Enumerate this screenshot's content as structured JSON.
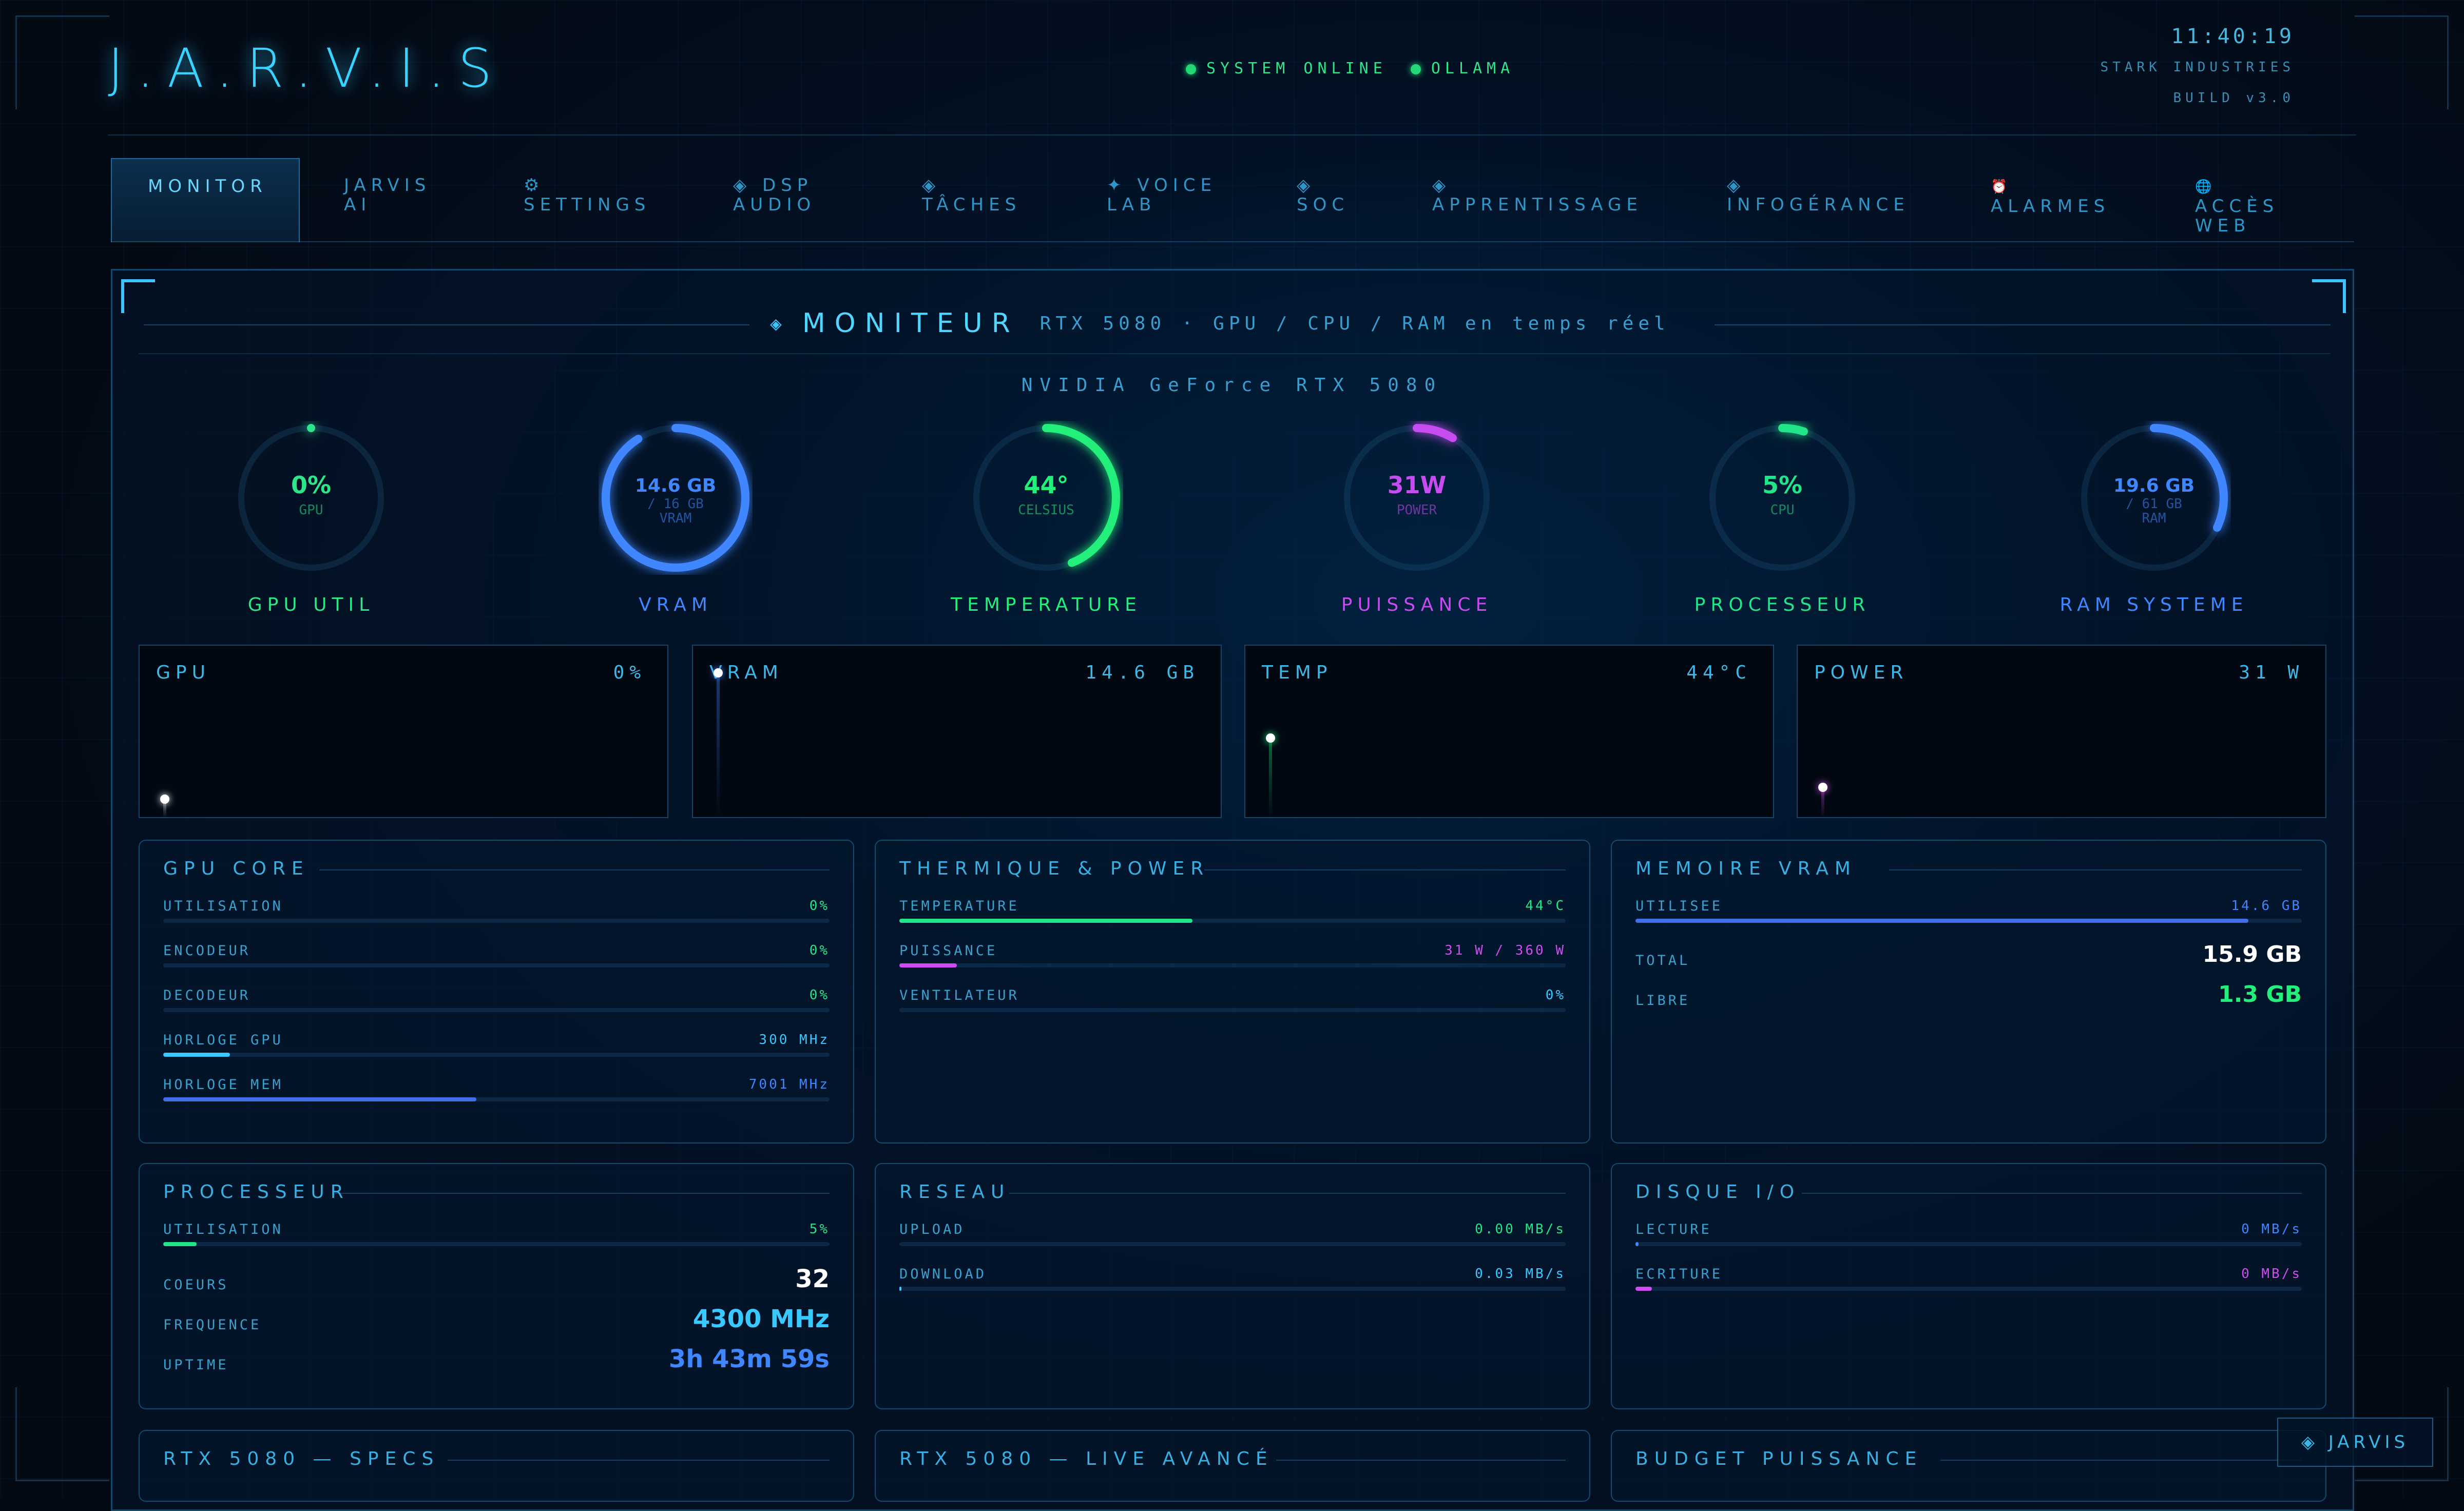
{
  "header": {
    "logo": "J.A.R.V.I.S",
    "status_1": "SYSTEM ONLINE",
    "status_2": "OLLAMA",
    "clock": "11:40:19",
    "company": "STARK INDUSTRIES",
    "build": "BUILD v3.0"
  },
  "tabs": [
    {
      "label": "MONITOR",
      "icon": "",
      "active": true
    },
    {
      "label": "JARVIS AI",
      "icon": ""
    },
    {
      "label": "SETTINGS",
      "icon": "⚙"
    },
    {
      "label": "DSP AUDIO",
      "icon": "◈"
    },
    {
      "label": "TÂCHES",
      "icon": "◈"
    },
    {
      "label": "VOICE LAB",
      "icon": "✦"
    },
    {
      "label": "SOC",
      "icon": "◈"
    },
    {
      "label": "APPRENTISSAGE",
      "icon": "◈"
    },
    {
      "label": "INFOGÉRANCE",
      "icon": "◈"
    },
    {
      "label": "ALARMES",
      "icon": "⏰"
    },
    {
      "label": "ACCÈS WEB",
      "icon": "🌐"
    }
  ],
  "section": {
    "icon": "◈",
    "title": "MONITEUR",
    "subtitle": "RTX 5080 · GPU / CPU / RAM en temps réel",
    "gpu_name": "NVIDIA GeForce RTX 5080"
  },
  "gauges": [
    {
      "value": "0%",
      "sub1": "GPU",
      "sub2": "",
      "label": "GPU UTIL",
      "fraction": 0.0,
      "color": "#2ee68a"
    },
    {
      "value": "14.6 GB",
      "sub1": "/ 16 GB",
      "sub2": "VRAM",
      "label": "VRAM",
      "fraction": 0.91,
      "color": "#3f86ff"
    },
    {
      "value": "44°",
      "sub1": "CELSIUS",
      "sub2": "",
      "label": "TEMPERATURE",
      "fraction": 0.44,
      "color": "#22f07a"
    },
    {
      "value": "31W",
      "sub1": "POWER",
      "sub2": "",
      "label": "PUISSANCE",
      "fraction": 0.086,
      "color": "#c64cf0"
    },
    {
      "value": "5%",
      "sub1": "CPU",
      "sub2": "",
      "label": "PROCESSEUR",
      "fraction": 0.05,
      "color": "#22e58a"
    },
    {
      "value": "19.6 GB",
      "sub1": "/ 61 GB",
      "sub2": "RAM",
      "label": "RAM SYSTEME",
      "fraction": 0.32,
      "color": "#3f86ff"
    }
  ],
  "sparks": [
    {
      "label": "GPU",
      "value": "0%",
      "level": 0.0,
      "color": "#ffffff"
    },
    {
      "label": "VRAM",
      "value": "14.6 GB",
      "level": 0.91,
      "color": "#3f86ff"
    },
    {
      "label": "TEMP",
      "value": "44°C",
      "level": 0.44,
      "color": "#22f07a"
    },
    {
      "label": "POWER",
      "value": "31 W",
      "level": 0.086,
      "color": "#e44cf0"
    }
  ],
  "gpu_core": {
    "title": "GPU CORE",
    "rows": [
      {
        "k": "UTILISATION",
        "v": "0%",
        "pct": 0
      },
      {
        "k": "ENCODEUR",
        "v": "0%",
        "pct": 0
      },
      {
        "k": "DECODEUR",
        "v": "0%",
        "pct": 0
      },
      {
        "k": "HORLOGE GPU",
        "v": "300 MHz",
        "pct": 0.1
      },
      {
        "k": "HORLOGE MEM",
        "v": "7001 MHz",
        "pct": 0.47
      }
    ]
  },
  "thermal": {
    "title": "THERMIQUE & POWER",
    "rows": [
      {
        "k": "TEMPERATURE",
        "v": "44°C",
        "pct": 0.44
      },
      {
        "k": "PUISSANCE",
        "v": "31 W / 360 W",
        "pct": 0.086
      },
      {
        "k": "VENTILATEUR",
        "v": "0%",
        "pct": 0
      }
    ]
  },
  "vram": {
    "title": "MEMOIRE VRAM",
    "used_k": "UTILISEE",
    "used_v": "14.6 GB",
    "used_pct": 0.92,
    "total_k": "TOTAL",
    "total_v": "15.9 GB",
    "free_k": "LIBRE",
    "free_v": "1.3 GB"
  },
  "cpu": {
    "title": "PROCESSEUR",
    "util_k": "UTILISATION",
    "util_v": "5%",
    "util_pct": 0.05,
    "cores_k": "COEURS",
    "cores_v": "32",
    "freq_k": "FREQUENCE",
    "freq_v": "4300 MHz",
    "uptime_k": "UPTIME",
    "uptime_v": "3h 43m 59s"
  },
  "network": {
    "title": "RESEAU",
    "rows": [
      {
        "k": "UPLOAD",
        "v": "0.00 MB/s",
        "pct": 0
      },
      {
        "k": "DOWNLOAD",
        "v": "0.03 MB/s",
        "pct": 0.003
      }
    ]
  },
  "disk": {
    "title": "DISQUE I/O",
    "rows": [
      {
        "k": "LECTURE",
        "v": "0 MB/s",
        "pct": 0.005
      },
      {
        "k": "ECRITURE",
        "v": "0 MB/s",
        "pct": 0.025
      }
    ]
  },
  "bottom_titles": [
    "RTX 5080 — SPECS",
    "RTX 5080 — LIVE AVANCÉ",
    "BUDGET PUISSANCE"
  ],
  "float_button": "◈ JARVIS",
  "colors": {
    "accent": "#3fc3ff",
    "green": "#2ee68a",
    "blue": "#3f86ff",
    "magenta": "#d04cf0"
  }
}
